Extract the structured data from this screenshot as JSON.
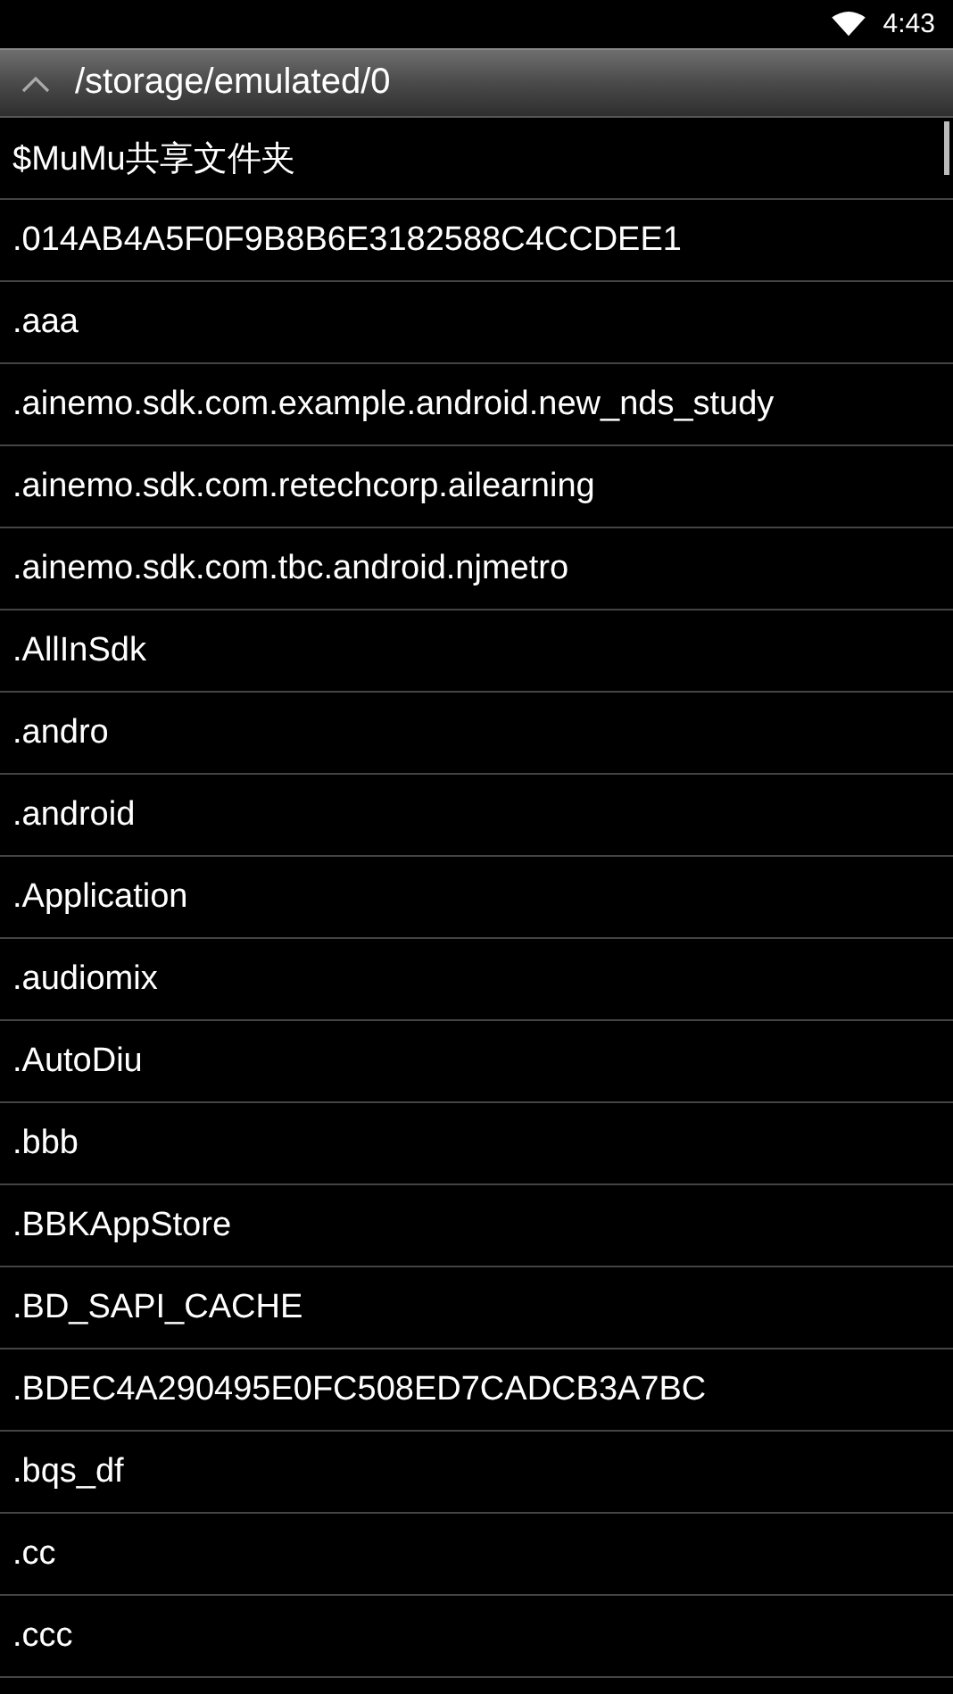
{
  "status_bar": {
    "time": "4:43"
  },
  "header": {
    "path": "/storage/emulated/0"
  },
  "files": [
    {
      "name": "$MuMu共享文件夹"
    },
    {
      "name": ".014AB4A5F0F9B8B6E3182588C4CCDEE1"
    },
    {
      "name": ".aaa"
    },
    {
      "name": ".ainemo.sdk.com.example.android.new_nds_study"
    },
    {
      "name": ".ainemo.sdk.com.retechcorp.ailearning"
    },
    {
      "name": ".ainemo.sdk.com.tbc.android.njmetro"
    },
    {
      "name": ".AllInSdk"
    },
    {
      "name": ".andro"
    },
    {
      "name": ".android"
    },
    {
      "name": ".Application"
    },
    {
      "name": ".audiomix"
    },
    {
      "name": ".AutoDiu"
    },
    {
      "name": ".bbb"
    },
    {
      "name": ".BBKAppStore"
    },
    {
      "name": ".BD_SAPI_CACHE"
    },
    {
      "name": ".BDEC4A290495E0FC508ED7CADCB3A7BC"
    },
    {
      "name": ".bqs_df"
    },
    {
      "name": ".cc"
    },
    {
      "name": ".ccc"
    }
  ]
}
